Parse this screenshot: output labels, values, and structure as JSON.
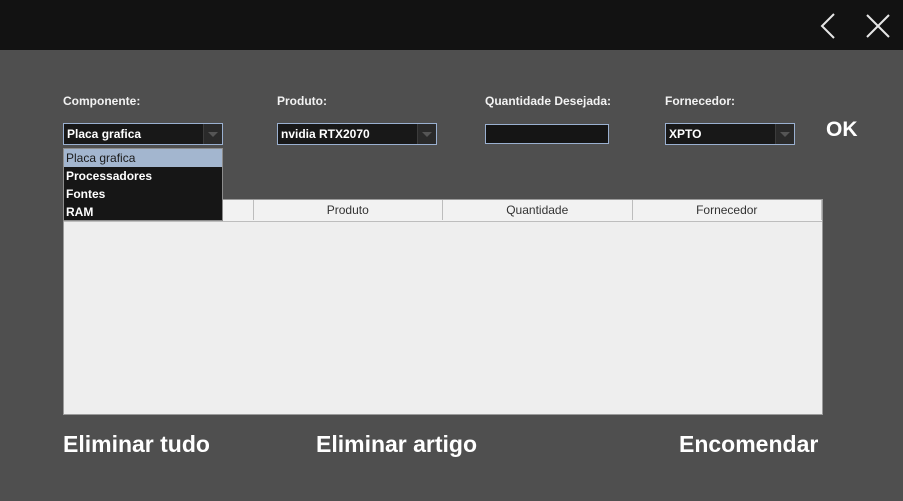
{
  "labels": {
    "componente": "Componente:",
    "produto": "Produto:",
    "quantidade": "Quantidade Desejada:",
    "fornecedor": "Fornecedor:"
  },
  "combos": {
    "componente": "Placa grafica",
    "produto": "nvidia RTX2070",
    "fornecedor": "XPTO"
  },
  "quantidade_value": "",
  "ok_label": "OK",
  "dropdown_items": [
    "Placa grafica",
    "Processadores",
    "Fontes",
    "RAM"
  ],
  "table": {
    "columns": [
      "",
      "Produto",
      "Quantidade",
      "Fornecedor"
    ]
  },
  "actions": {
    "eliminar_tudo": "Eliminar tudo",
    "eliminar_artigo": "Eliminar artigo",
    "encomendar": "Encomendar"
  },
  "colors": {
    "background": "#4f4f4f",
    "titlebar": "#121212",
    "selection": "#a3b6cf"
  },
  "icons": {
    "back": "chevron-left-icon",
    "close": "close-icon"
  }
}
